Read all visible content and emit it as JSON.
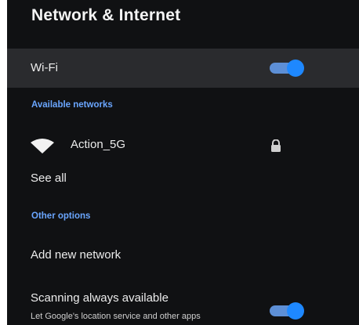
{
  "header": {
    "title": "Network & Internet"
  },
  "wifi": {
    "label": "Wi-Fi",
    "enabled": true
  },
  "available_networks": {
    "section_label": "Available networks",
    "networks": [
      {
        "name": "Action_5G",
        "secured": true,
        "icon": "wifi-signal-icon"
      }
    ],
    "see_all_label": "See all"
  },
  "other_options": {
    "section_label": "Other options",
    "add_network_label": "Add new network",
    "scanning": {
      "label": "Scanning always available",
      "description": "Let Google's location service and other apps",
      "enabled": true
    }
  },
  "colors": {
    "background": "#101113",
    "highlight_row": "#2a2b2e",
    "accent": "#1e88ff",
    "section_text": "#6aa6ff"
  }
}
